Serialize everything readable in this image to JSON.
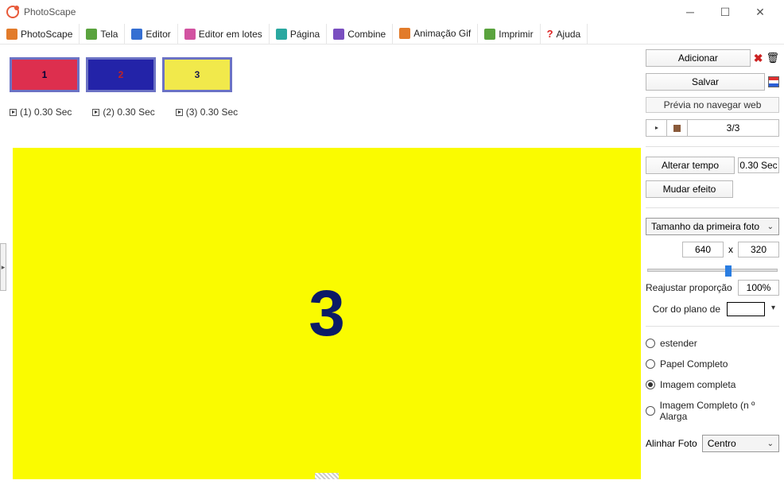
{
  "window": {
    "title": "PhotoScape"
  },
  "tabs": [
    {
      "label": "PhotoScape"
    },
    {
      "label": "Tela"
    },
    {
      "label": "Editor"
    },
    {
      "label": "Editor em lotes"
    },
    {
      "label": "Página"
    },
    {
      "label": "Combine"
    },
    {
      "label": "Animação Gif"
    },
    {
      "label": "Imprimir"
    },
    {
      "label": "Ajuda"
    }
  ],
  "thumbs": [
    {
      "num": "1",
      "time": "(1) 0.30 Sec"
    },
    {
      "num": "2",
      "time": "(2) 0.30 Sec"
    },
    {
      "num": "3",
      "time": "(3) 0.30 Sec"
    }
  ],
  "canvas": {
    "number": "3"
  },
  "side": {
    "add": "Adicionar",
    "save": "Salvar",
    "preview_web": "Prévia no navegar web",
    "counter": "3/3",
    "change_time": "Alterar tempo",
    "time_val": "0.30 Sec",
    "change_effect": "Mudar efeito",
    "size_combo": "Tamanho da primeira foto",
    "width": "640",
    "x_label": "x",
    "height": "320",
    "readjust": "Reajustar proporção",
    "percent": "100%",
    "bgcolor_label": "Cor do plano de",
    "radios": {
      "extend": "estender",
      "full_paper": "Papel Completo",
      "full_image": "Imagem completa",
      "full_image_no_enlarge": "Imagem Completo (n º Alarga"
    },
    "align_label": "Alinhar Foto",
    "align_value": "Centro"
  }
}
